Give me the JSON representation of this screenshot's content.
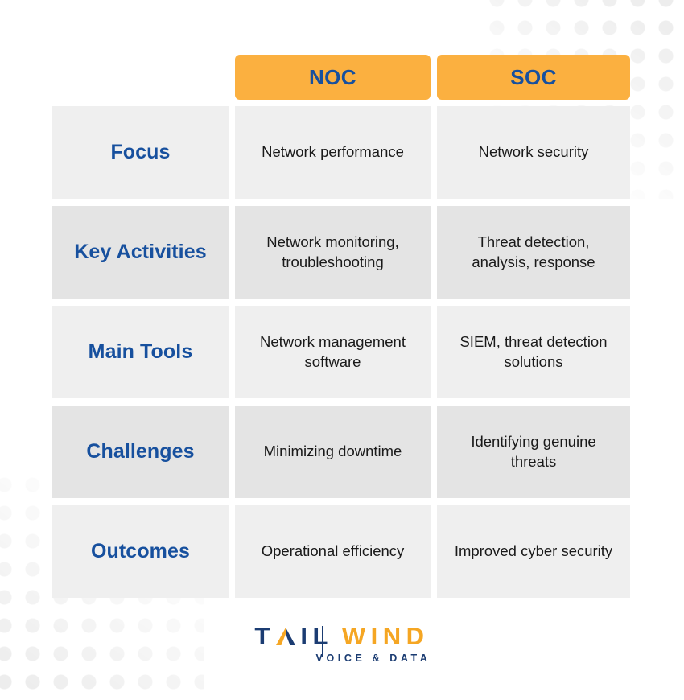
{
  "theme": {
    "accent_orange": "#fbb040",
    "accent_blue": "#17509e",
    "logo_navy": "#1b3c72",
    "logo_gold": "#f5a623",
    "row_shade_light": "#efefef",
    "row_shade_dark": "#e4e4e4",
    "page_background": "#ffffff"
  },
  "table": {
    "columns": [
      {
        "key": "label",
        "header": ""
      },
      {
        "key": "noc",
        "header": "NOC"
      },
      {
        "key": "soc",
        "header": "SOC"
      }
    ],
    "rows": [
      {
        "label": "Focus",
        "noc": "Network performance",
        "soc": "Network security"
      },
      {
        "label": "Key Activities",
        "noc": "Network monitoring, troubleshooting",
        "soc": "Threat detection, analysis, response"
      },
      {
        "label": "Main Tools",
        "noc": "Network management software",
        "soc": "SIEM, threat detection solutions"
      },
      {
        "label": "Challenges",
        "noc": "Minimizing downtime",
        "soc": "Identifying genuine threats"
      },
      {
        "label": "Outcomes",
        "noc": "Operational efficiency",
        "soc": "Improved cyber security"
      }
    ]
  },
  "logo": {
    "word_first": "T",
    "word_first_rest": "IL",
    "word_second": "WIND",
    "tagline": "VOICE & DATA",
    "mark_name": "tailwind-arrow-a"
  }
}
